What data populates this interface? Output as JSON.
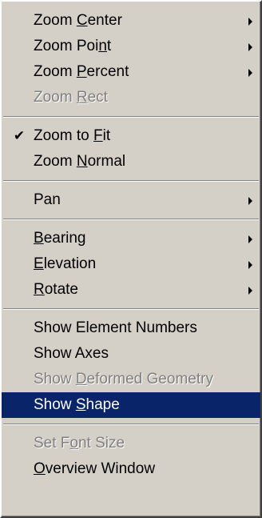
{
  "menu": {
    "groups": [
      {
        "items": [
          {
            "pre": "Zoom ",
            "key": "C",
            "post": "enter",
            "submenu": true,
            "disabled": false
          },
          {
            "pre": "Zoom Poi",
            "key": "n",
            "post": "t",
            "submenu": true,
            "disabled": false
          },
          {
            "pre": "Zoom ",
            "key": "P",
            "post": "ercent",
            "submenu": true,
            "disabled": false
          },
          {
            "pre": "Zoom ",
            "key": "R",
            "post": "ect",
            "submenu": false,
            "disabled": true
          }
        ]
      },
      {
        "items": [
          {
            "check": "✔",
            "pre": "Zoom to ",
            "key": "F",
            "post": "it",
            "checked": true
          },
          {
            "pre": "Zoom ",
            "key": "N",
            "post": "ormal"
          }
        ]
      },
      {
        "items": [
          {
            "label": "Pan",
            "submenu": true
          }
        ]
      },
      {
        "items": [
          {
            "pre": "",
            "key": "B",
            "post": "earing",
            "submenu": true
          },
          {
            "pre": "",
            "key": "E",
            "post": "levation",
            "submenu": true
          },
          {
            "pre": "",
            "key": "R",
            "post": "otate",
            "submenu": true
          }
        ]
      },
      {
        "items": [
          {
            "label": "Show Element Numbers"
          },
          {
            "label": "Show Axes"
          },
          {
            "pre": "Show ",
            "key": "D",
            "post": "eformed Geometry",
            "disabled": true
          },
          {
            "pre": "Show ",
            "key": "S",
            "post": "hape",
            "highlighted": true
          }
        ]
      },
      {
        "items": [
          {
            "pre": "Set F",
            "key": "o",
            "post": "nt Size",
            "disabled": true
          },
          {
            "pre": "",
            "key": "O",
            "post": "verview Window"
          }
        ]
      }
    ]
  },
  "colors": {
    "menu_bg": "#d4d0c8",
    "highlight_bg": "#0a246a",
    "highlight_text": "#ffffff",
    "disabled_text": "#808080"
  }
}
